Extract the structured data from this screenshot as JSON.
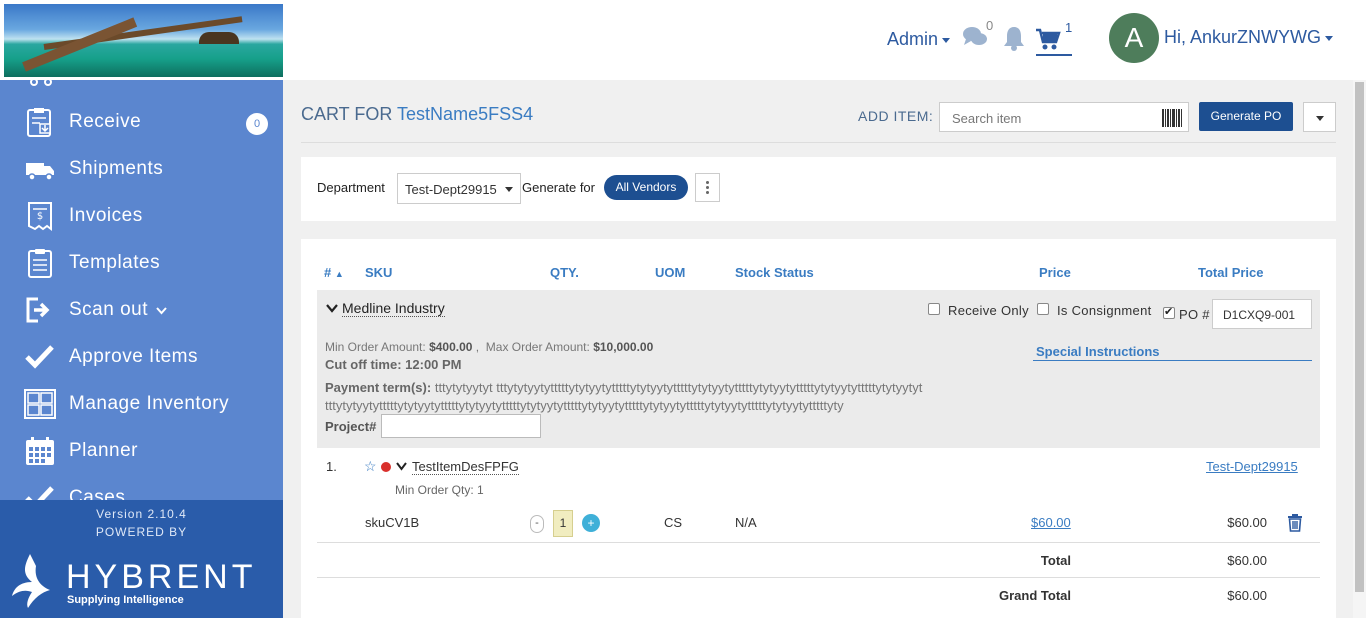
{
  "header": {
    "admin_label": "Admin",
    "chat_count": "0",
    "cart_count": "1",
    "avatar_letter": "A",
    "user_greeting": "Hi, AnkurZNWYWG"
  },
  "sidebar": {
    "items": [
      {
        "label": "Receive",
        "badge": "0"
      },
      {
        "label": "Shipments"
      },
      {
        "label": "Invoices"
      },
      {
        "label": "Templates"
      },
      {
        "label": "Scan out"
      },
      {
        "label": "Approve Items"
      },
      {
        "label": "Manage Inventory"
      },
      {
        "label": "Planner"
      },
      {
        "label": "Cases"
      }
    ],
    "version": "Version 2.10.4",
    "powered_by": "POWERED BY",
    "brand": "HYBRENT",
    "tagline": "Supplying Intelligence"
  },
  "cart": {
    "title_prefix": "CART FOR",
    "title_name": "TestName5FSS4",
    "add_item_label": "ADD ITEM:",
    "search_placeholder": "Search item",
    "generate_po_label": "Generate PO",
    "department_label": "Department",
    "department_value": "Test-Dept29915",
    "generate_for_label": "Generate for",
    "all_vendors_label": "All Vendors"
  },
  "table": {
    "headers": {
      "num": "#",
      "sku": "SKU",
      "qty": "QTY.",
      "uom": "UOM",
      "stock": "Stock Status",
      "price": "Price",
      "total": "Total Price"
    },
    "vendor": {
      "name": "Medline Industry",
      "receive_only": "Receive Only",
      "is_consignment": "Is Consignment",
      "po_label": "PO #",
      "po_value": "D1CXQ9-001",
      "min_order_label": "Min Order Amount:",
      "min_order_value": "$400.00",
      "max_order_label": "Max Order Amount:",
      "max_order_value": "$10,000.00",
      "cutoff": "Cut off time: 12:00 PM",
      "special_instructions": "Special Instructions",
      "payment_terms_label": "Payment term(s):",
      "payment_terms_value": "tttytytyytyt tttytytyytytttttytytyytytttttytytyytytttttytytyytytttttytytyytytttttytytyytytttttytytyytyt tttytytyytytttttytytyytytttttytytyytytttttytytyytytttttytytyytytttttytytyytytttttytytyytytttttytytyytytttttyty",
      "project_label": "Project#"
    },
    "row": {
      "num": "1.",
      "item_name": "TestItemDesFPFG",
      "department": "Test-Dept29915",
      "min_qty": "Min Order Qty: 1",
      "sku": "skuCV1B",
      "minus": "-",
      "qty": "1",
      "plus": "+",
      "uom": "CS",
      "stock_status": "N/A",
      "price": "$60.00",
      "total": "$60.00"
    },
    "total_label": "Total",
    "total_value": "$60.00",
    "grand_total_label": "Grand Total",
    "grand_total_value": "$60.00"
  },
  "colors": {
    "sidebar": "#5b86cf",
    "sidebar_footer": "#2a5caa",
    "primary_button": "#1d4f91",
    "link": "#3a7cc2"
  }
}
